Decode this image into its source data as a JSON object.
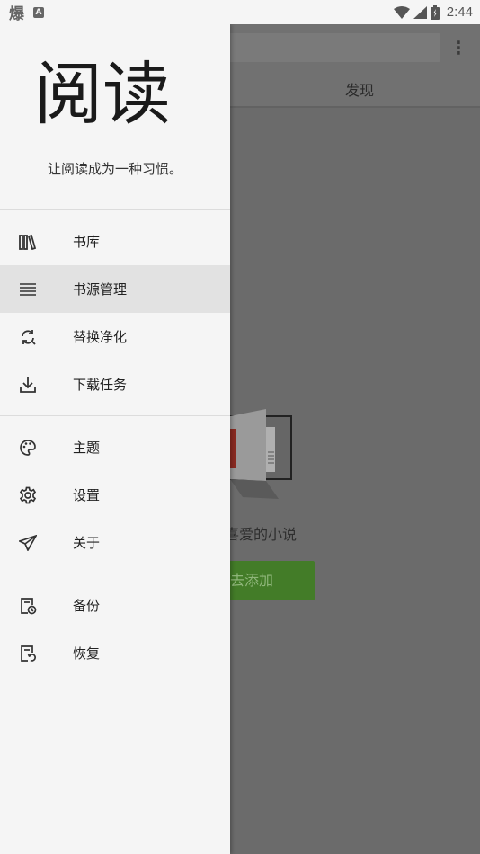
{
  "status_bar": {
    "app_glyph": "爆",
    "notification_badge": "A",
    "time": "2:44"
  },
  "background_screen": {
    "tab_label": "发现",
    "empty_text": "喜爱的小说",
    "add_button_label": "去添加",
    "add_button_color": "#437c28"
  },
  "drawer": {
    "logo_text": "阅读",
    "slogan": "让阅读成为一种习惯。",
    "groups": [
      [
        {
          "label": "书库",
          "icon": "bookshelf-icon",
          "active": false
        },
        {
          "label": "书源管理",
          "icon": "list-icon",
          "active": true
        },
        {
          "label": "替换净化",
          "icon": "replace-icon",
          "active": false
        },
        {
          "label": "下载任务",
          "icon": "download-icon",
          "active": false
        }
      ],
      [
        {
          "label": "主题",
          "icon": "palette-icon",
          "active": false
        },
        {
          "label": "设置",
          "icon": "gear-icon",
          "active": false
        },
        {
          "label": "关于",
          "icon": "send-icon",
          "active": false
        }
      ],
      [
        {
          "label": "备份",
          "icon": "backup-icon",
          "active": false
        },
        {
          "label": "恢复",
          "icon": "restore-icon",
          "active": false
        }
      ]
    ]
  }
}
